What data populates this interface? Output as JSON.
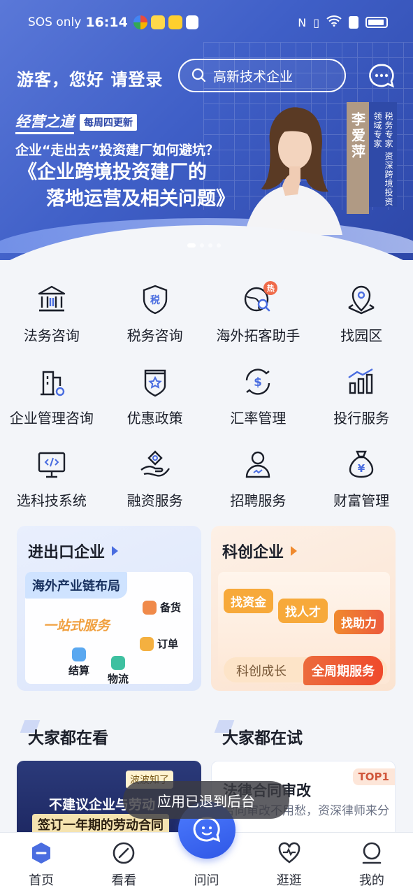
{
  "status_bar": {
    "carrier": "SOS only",
    "time": "16:14",
    "app_icons": [
      "app-icon-1",
      "app-icon-2",
      "app-icon-3",
      "app-icon-4"
    ],
    "right_icons": [
      "nfc-icon",
      "vibrate-icon",
      "wifi-icon",
      "alert-icon",
      "battery-icon"
    ]
  },
  "header": {
    "greeting": "游客，您好 请登录",
    "search_value": "高新技术企业",
    "message_icon": "chat-bubble-icon"
  },
  "banner": {
    "brand": "经营之道",
    "brand_tag": "每周四更新",
    "line1": "企业“走出去”投资建厂如何避坑？",
    "line2a": "《企业跨境投资建厂的",
    "line2b": "落地运营及相关问题》",
    "person_name": "李爱萍",
    "person_title": "税务专家 资深跨境投资领域专家",
    "dots": 4,
    "active_dot": 0
  },
  "services": [
    {
      "label": "法务咨询",
      "icon": "courthouse-icon"
    },
    {
      "label": "税务咨询",
      "icon": "tax-shield-icon"
    },
    {
      "label": "海外拓客助手",
      "icon": "globe-search-icon",
      "badge": "热"
    },
    {
      "label": "找园区",
      "icon": "map-pin-icon"
    },
    {
      "label": "企业管理咨询",
      "icon": "building-gear-icon"
    },
    {
      "label": "优惠政策",
      "icon": "badge-star-icon"
    },
    {
      "label": "汇率管理",
      "icon": "exchange-dollar-icon"
    },
    {
      "label": "投行服务",
      "icon": "bar-chart-up-icon"
    },
    {
      "label": "选科技系统",
      "icon": "monitor-code-icon"
    },
    {
      "label": "融资服务",
      "icon": "hand-money-icon"
    },
    {
      "label": "招聘服务",
      "icon": "person-icon"
    },
    {
      "label": "财富管理",
      "icon": "money-bag-icon"
    }
  ],
  "cards": {
    "import_export": {
      "title": "进出口企业",
      "chip": "海外产业链布局",
      "slogan": "一站式服务",
      "items": [
        "备货",
        "订单",
        "结算",
        "物流"
      ]
    },
    "tech": {
      "title": "科创企业",
      "pills": [
        "找资金",
        "找人才",
        "找助力"
      ],
      "bottom_left": "科创成长",
      "bottom_right": "全周期服务"
    }
  },
  "sections": {
    "watching": {
      "title": "大家都在看",
      "feed_tag": "波波知了",
      "feed_line1": "不建议企业与劳动",
      "feed_line2": "签订一年期的劳动合同"
    },
    "trying": {
      "title": "大家都在试",
      "badge": "TOP1",
      "feed_title": "法律合同审改",
      "feed_desc": "合同审改不用愁，资深律师来分忧"
    }
  },
  "toast": "应用已退到后台",
  "tabbar": [
    {
      "label": "首页",
      "icon": "home-icon",
      "active": true
    },
    {
      "label": "看看",
      "icon": "compass-icon"
    },
    {
      "label": "问问",
      "icon": "ask-bubble-icon"
    },
    {
      "label": "逛逛",
      "icon": "heart-pulse-icon"
    },
    {
      "label": "我的",
      "icon": "profile-icon"
    }
  ],
  "colors": {
    "hero": "#3f5fc7",
    "accent": "#2f57e6",
    "orange": "#f08a2e",
    "hot": "#ef6b4a"
  }
}
